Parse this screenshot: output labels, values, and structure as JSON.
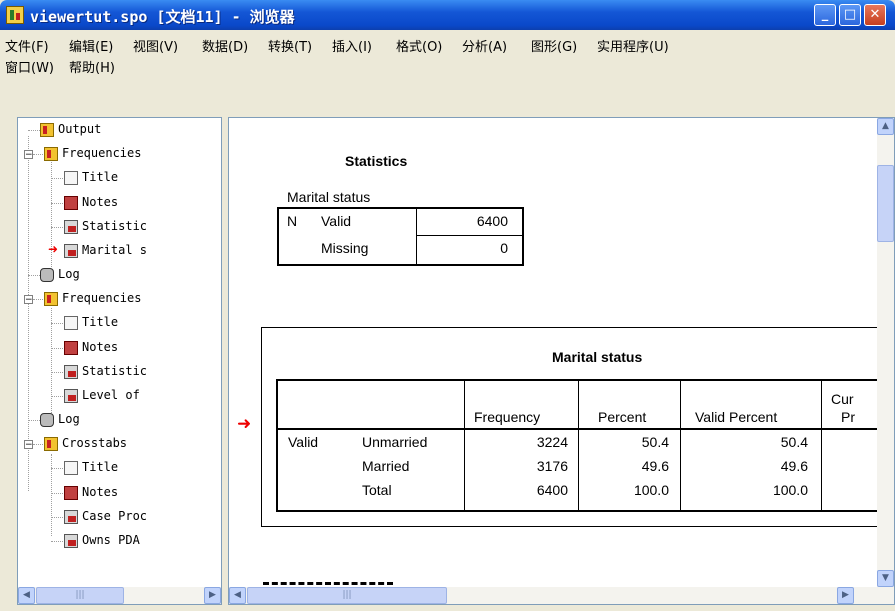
{
  "window": {
    "title": "viewertut.spo [文档11] - 浏览器",
    "controls": {
      "minimize": "_",
      "maximize": "□",
      "close": "✕"
    }
  },
  "menu": {
    "row1": [
      "文件(F)",
      "编辑(E)",
      "视图(V)",
      "数据(D)",
      "转换(T)",
      "插入(I)",
      "格式(O)",
      "分析(A)",
      "图形(G)",
      "实用程序(U)"
    ],
    "row2": [
      "窗口(W)",
      "帮助(H)"
    ]
  },
  "outline": {
    "items": [
      {
        "label": "Output",
        "icon": "book-icon"
      },
      {
        "label": "Frequencies",
        "icon": "book-icon"
      },
      {
        "label": "Title",
        "icon": "title-doc-icon"
      },
      {
        "label": "Notes",
        "icon": "notes-icon"
      },
      {
        "label": "Statistic",
        "icon": "table-icon"
      },
      {
        "label": "Marital s",
        "icon": "table-icon"
      },
      {
        "label": "Log",
        "icon": "log-icon"
      },
      {
        "label": "Frequencies",
        "icon": "book-icon"
      },
      {
        "label": "Title",
        "icon": "title-doc-icon"
      },
      {
        "label": "Notes",
        "icon": "notes-icon"
      },
      {
        "label": "Statistic",
        "icon": "table-icon"
      },
      {
        "label": "Level of",
        "icon": "table-icon"
      },
      {
        "label": "Log",
        "icon": "log-icon"
      },
      {
        "label": "Crosstabs",
        "icon": "book-icon"
      },
      {
        "label": "Title",
        "icon": "title-doc-icon"
      },
      {
        "label": "Notes",
        "icon": "notes-icon"
      },
      {
        "label": "Case Proc",
        "icon": "table-icon"
      },
      {
        "label": "Owns PDA",
        "icon": "table-icon"
      }
    ],
    "expand_collapse": "−"
  },
  "statistics_table": {
    "title": "Statistics",
    "subtitle": "Marital status",
    "rows": [
      {
        "c1": "N",
        "c2": "Valid",
        "value": "6400"
      },
      {
        "c1": "",
        "c2": "Missing",
        "value": "0"
      }
    ]
  },
  "marital_table": {
    "title": "Marital status",
    "headers": [
      "Frequency",
      "Percent",
      "Valid Percent",
      "Cur",
      "Pr"
    ],
    "group": "Valid",
    "rows": [
      {
        "label": "Unmarried",
        "frequency": "3224",
        "percent": "50.4",
        "valid_percent": "50.4"
      },
      {
        "label": "Married",
        "frequency": "3176",
        "percent": "49.6",
        "valid_percent": "49.6"
      },
      {
        "label": "Total",
        "frequency": "6400",
        "percent": "100.0",
        "valid_percent": "100.0"
      }
    ]
  },
  "scrollbars": {
    "thumb_grip": "|||",
    "up": "▲",
    "down": "▼",
    "left": "◀",
    "right": "▶"
  },
  "icons": {
    "pointer": "➜"
  }
}
